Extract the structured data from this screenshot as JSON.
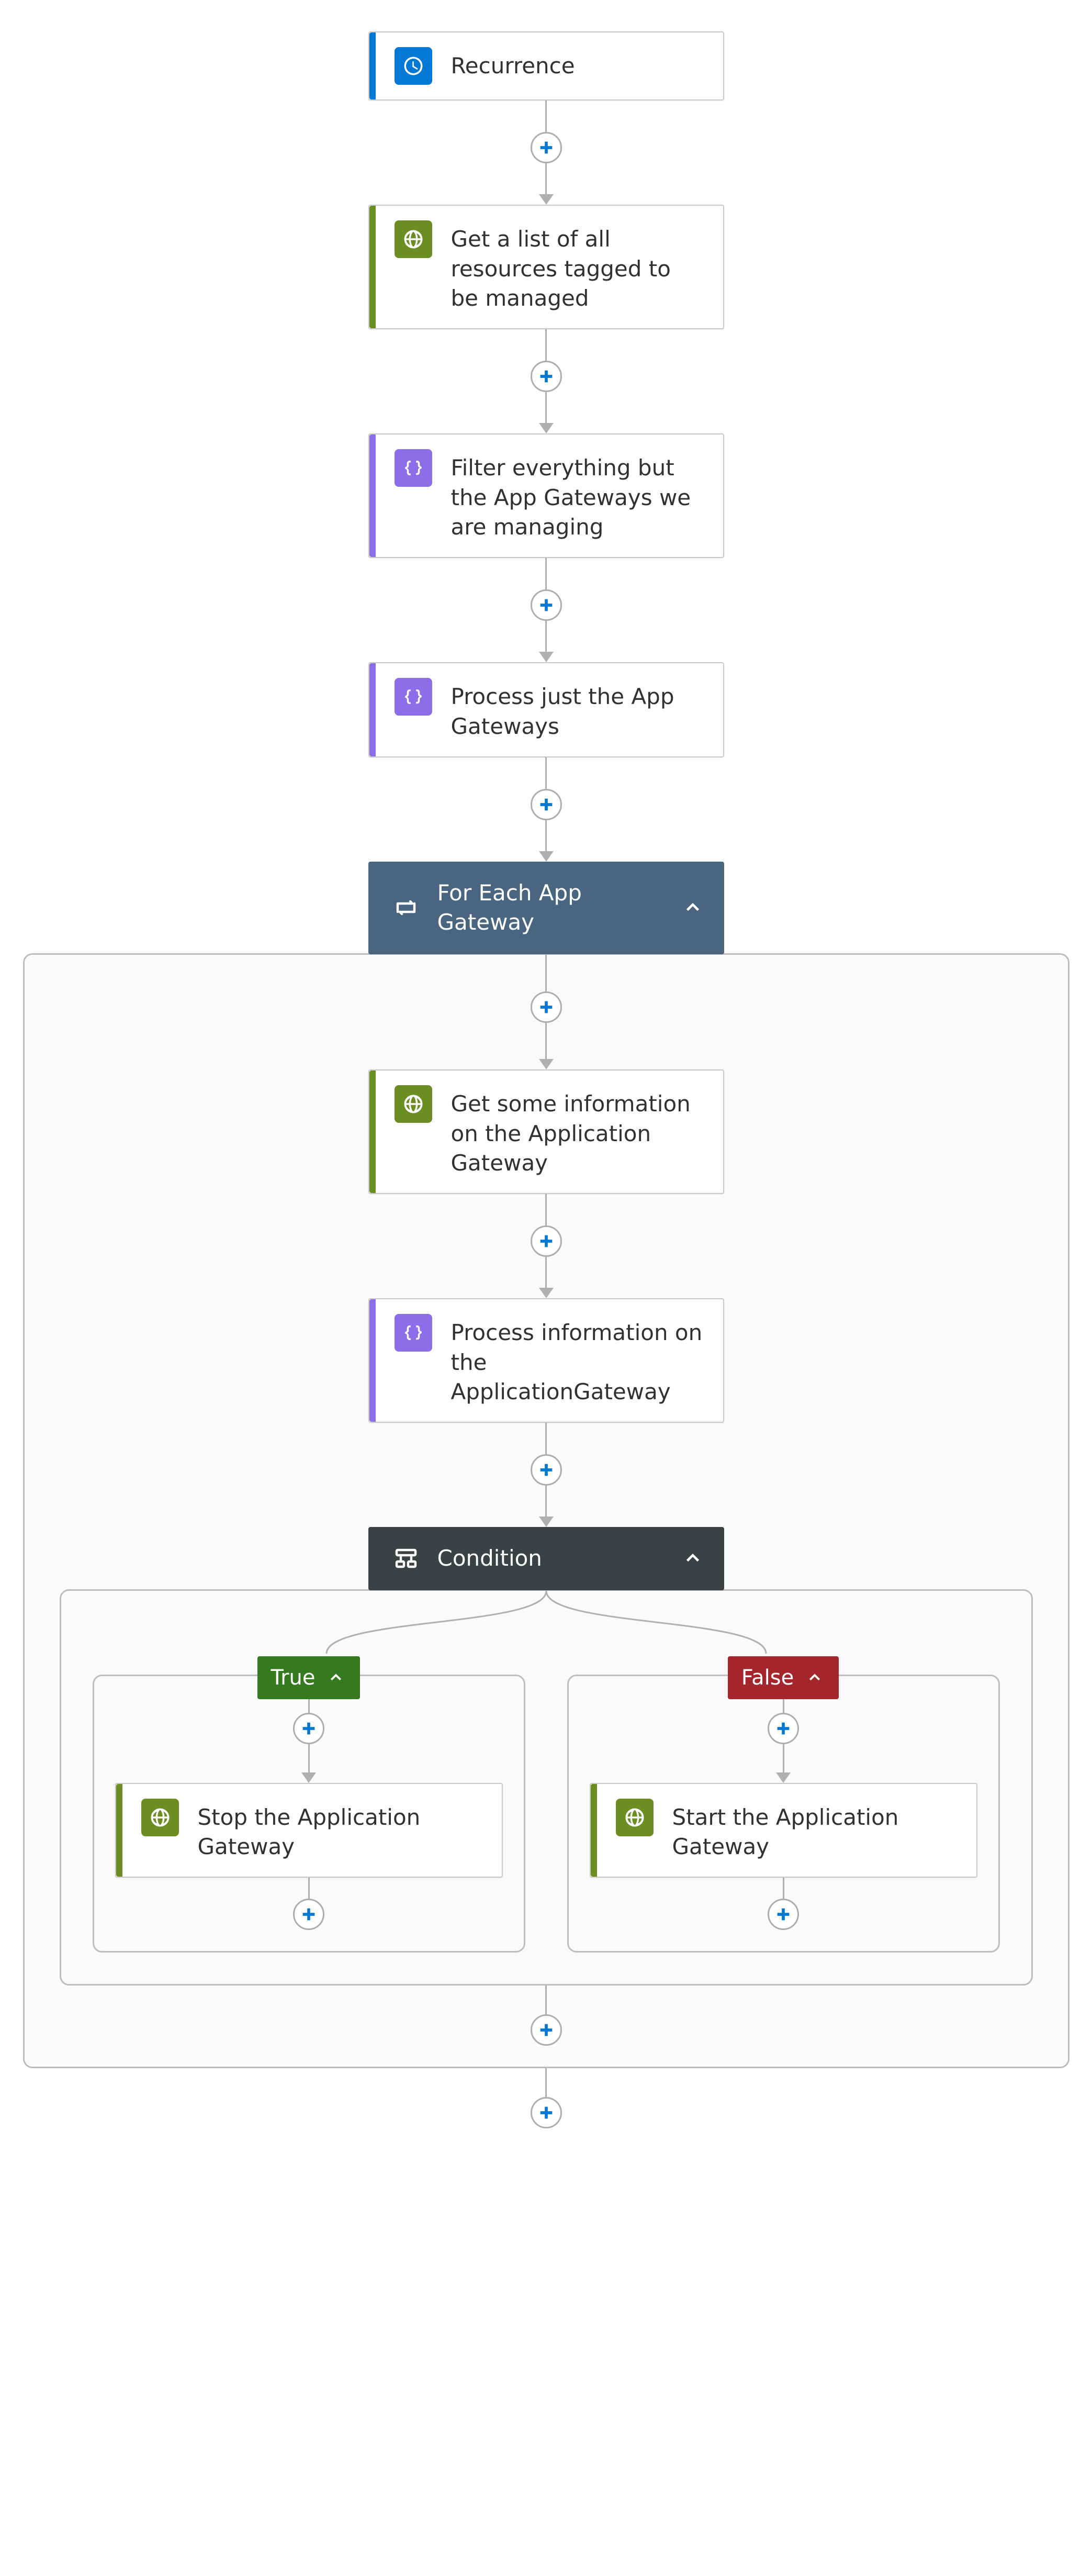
{
  "cards": {
    "recurrence": {
      "label": "Recurrence"
    },
    "get_resources": {
      "label": "Get a list of all resources tagged to be managed"
    },
    "filter": {
      "label": "Filter everything but the App Gateways we are managing"
    },
    "process_gw": {
      "label": "Process just the App Gateways"
    },
    "for_each": {
      "label": "For Each App Gateway"
    },
    "get_info": {
      "label": "Get some information on the Application Gateway"
    },
    "process_info": {
      "label": "Process information on the ApplicationGateway"
    },
    "condition": {
      "label": "Condition"
    },
    "stop": {
      "label": "Stop the Application Gateway"
    },
    "start": {
      "label": "Start the Application Gateway"
    }
  },
  "badges": {
    "true": "True",
    "false": "False"
  },
  "colors": {
    "blue": "#0078d4",
    "green": "#6b8e23",
    "purple": "#8c6ee8",
    "slate": "#4a6580",
    "charcoal": "#3c4144",
    "badge_green": "#357a1e",
    "badge_red": "#a4262c"
  }
}
